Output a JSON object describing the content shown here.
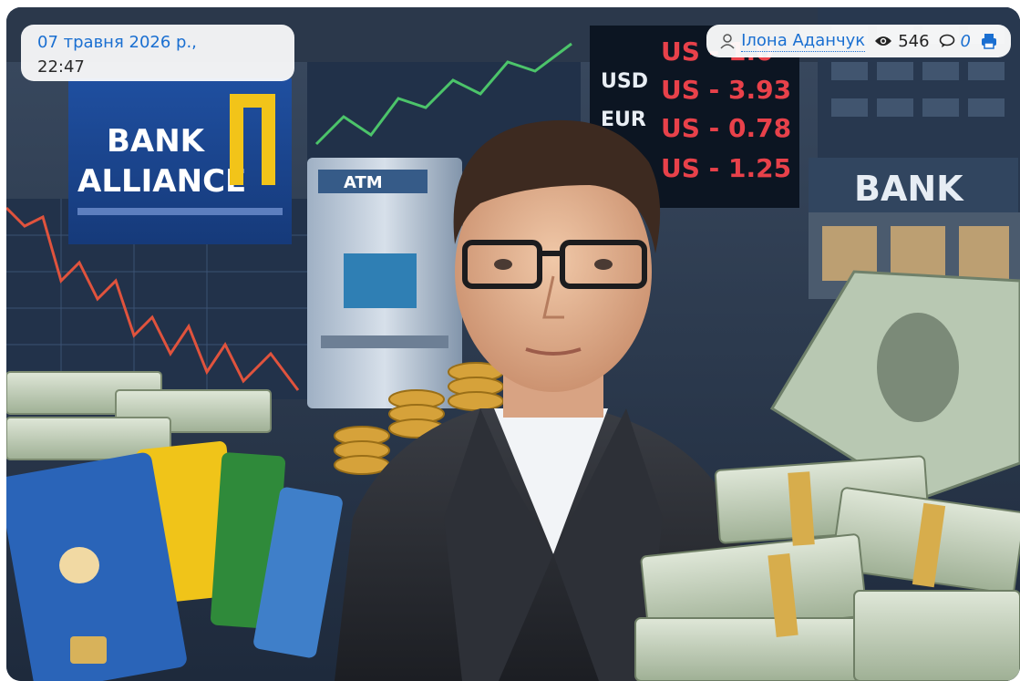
{
  "article": {
    "date": "07 травня 2026 р.,",
    "time": "22:47",
    "author": "Ілона Аданчук",
    "views": "546",
    "comments": "0"
  },
  "image": {
    "bank_logo_line1": "BANK",
    "bank_logo_line2": "ALLIANCE",
    "atm_label": "ATM",
    "bank_sign": "BANK",
    "rate_labels": [
      "USD",
      "EUR"
    ],
    "rates": [
      "US - 1.0",
      "US - 3.93",
      "US - 0.78",
      "US - 1.25"
    ]
  },
  "icons": {
    "author": "user-icon",
    "views": "eye-icon",
    "comments": "comment-icon",
    "print": "print-icon"
  },
  "colors": {
    "link": "#1a6fd1",
    "print": "#1a6fd1"
  }
}
